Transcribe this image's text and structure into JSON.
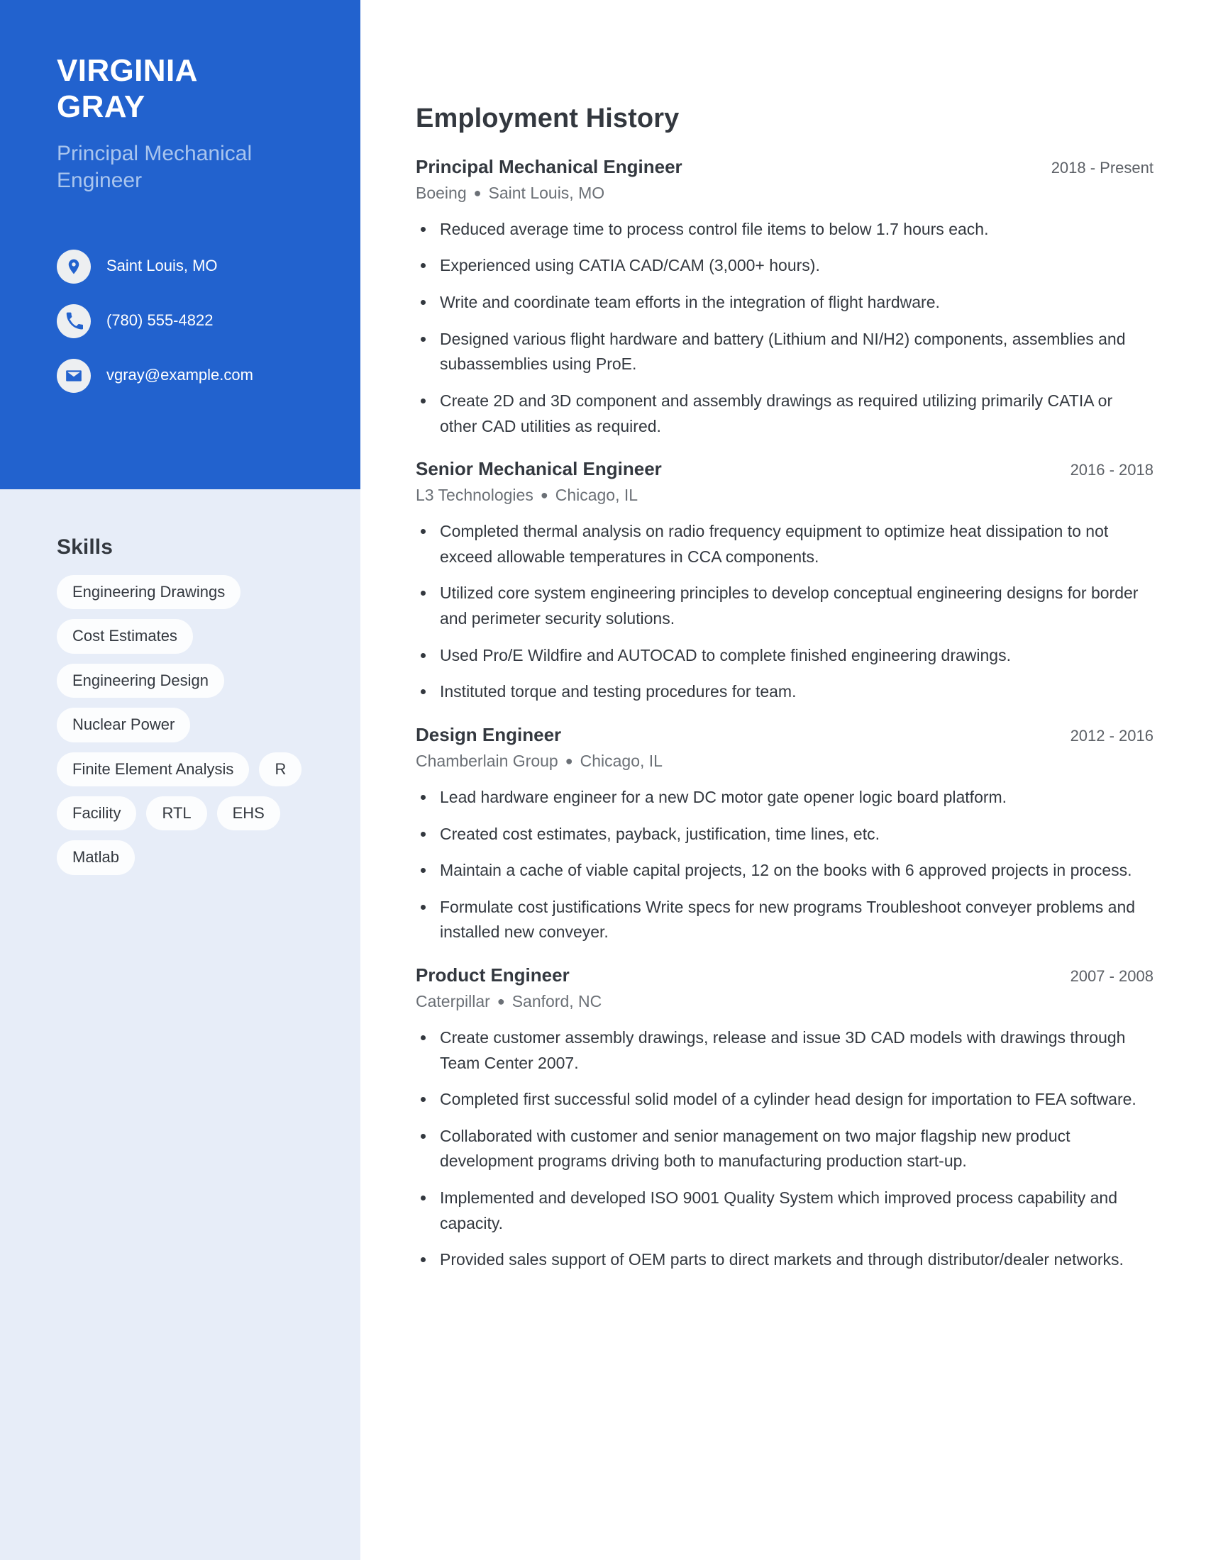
{
  "colors": {
    "sidebar_blue": "#2262CE",
    "sidebar_light": "#E7EDF8",
    "subtitle_blue": "#A9C5EE",
    "text_dark": "#33383F",
    "text_muted": "#6B7076",
    "tag_bg": "#FCFDFE"
  },
  "sidebar": {
    "name_line1": "VIRGINIA",
    "name_line2": "GRAY",
    "job_title": "Principal Mechanical Engineer",
    "contacts": [
      {
        "icon": "location-pin-icon",
        "value": "Saint Louis, MO"
      },
      {
        "icon": "phone-icon",
        "value": "(780) 555-4822"
      },
      {
        "icon": "envelope-icon",
        "value": "vgray@example.com"
      }
    ],
    "skills_heading": "Skills",
    "skills": [
      "Engineering Drawings",
      "Cost Estimates",
      "Engineering Design",
      "Nuclear Power",
      "Finite Element Analysis",
      "R",
      "Facility",
      "RTL",
      "EHS",
      "Matlab"
    ]
  },
  "main": {
    "section_title": "Employment History",
    "separator": "●",
    "jobs": [
      {
        "role": "Principal Mechanical Engineer",
        "dates": "2018 - Present",
        "company": "Boeing",
        "location": "Saint Louis, MO",
        "bullets": [
          "Reduced average time to process control file items to below 1.7 hours each.",
          "Experienced using CATIA CAD/CAM (3,000+ hours).",
          "Write and coordinate team efforts in the integration of flight hardware.",
          "Designed various flight hardware and battery (Lithium and NI/H2) components, assemblies and subassemblies using ProE.",
          "Create 2D and 3D component and assembly drawings as required utilizing primarily CATIA or other CAD utilities as required."
        ]
      },
      {
        "role": "Senior Mechanical Engineer",
        "dates": "2016 - 2018",
        "company": "L3 Technologies",
        "location": "Chicago, IL",
        "bullets": [
          "Completed thermal analysis on radio frequency equipment to optimize heat dissipation to not exceed allowable temperatures in CCA components.",
          "Utilized core system engineering principles to develop conceptual engineering designs for border and perimeter security solutions.",
          "Used Pro/E Wildfire and AUTOCAD to complete finished engineering drawings.",
          "Instituted torque and testing procedures for team."
        ]
      },
      {
        "role": "Design Engineer",
        "dates": "2012 - 2016",
        "company": "Chamberlain Group",
        "location": "Chicago, IL",
        "bullets": [
          "Lead hardware engineer for a new DC motor gate opener logic board platform.",
          "Created cost estimates, payback, justification, time lines, etc.",
          "Maintain a cache of viable capital projects, 12 on the books with 6 approved projects in process.",
          "Formulate cost justifications Write specs for new programs Troubleshoot conveyer problems and installed new conveyer."
        ]
      },
      {
        "role": "Product Engineer",
        "dates": "2007 - 2008",
        "company": "Caterpillar",
        "location": "Sanford, NC",
        "bullets": [
          "Create customer assembly drawings, release and issue 3D CAD models with drawings through Team Center 2007.",
          "Completed first successful solid model of a cylinder head design for importation to FEA software.",
          "Collaborated with customer and senior management on two major flagship new product development programs driving both to manufacturing production start-up.",
          "Implemented and developed ISO 9001 Quality System which improved process capability and capacity.",
          "Provided sales support of OEM parts to direct markets and through distributor/dealer networks."
        ]
      }
    ]
  }
}
